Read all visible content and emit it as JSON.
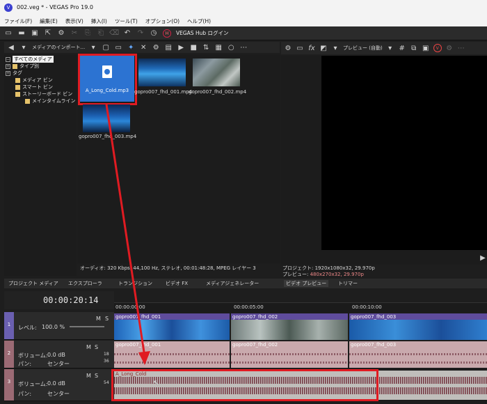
{
  "window": {
    "title": "002.veg * - VEGAS Pro 19.0"
  },
  "menu": [
    "ファイル(F)",
    "編集(E)",
    "表示(V)",
    "挿入(I)",
    "ツール(T)",
    "オプション(O)",
    "ヘルプ(H)"
  ],
  "toolbar": {
    "hub_label": "VEGAS Hub ログイン"
  },
  "media": {
    "import_label": "メディアのインポート...",
    "tree": [
      {
        "label": "すべてのメディア"
      },
      {
        "label": "タイプ別"
      },
      {
        "label": "タグ"
      },
      {
        "label": "メディア ビン"
      },
      {
        "label": "スマート ビン"
      },
      {
        "label": "ストーリーボード ビン"
      },
      {
        "label": "メインタイムライン"
      }
    ],
    "items": [
      {
        "name": "A_Long_Cold.mp3"
      },
      {
        "name": "gopro007_fhd_001.mp4"
      },
      {
        "name": "gopro007_fhd_002.mp4"
      },
      {
        "name": "gopro007_fhd_003.mp4"
      }
    ],
    "status": "オーディオ: 320 Kbps, 44,100 Hz, ステレオ, 00:01:48:28, MPEG レイヤー 3"
  },
  "tabs": [
    "プロジェクト メディア",
    "エクスプローラ",
    "トランジション",
    "ビデオ FX",
    "メディアジェネレーター",
    "ビデオ プレビュー",
    "トリマー"
  ],
  "preview": {
    "mode_label": "プレビュー (自動)",
    "project_line": "プロジェクト: 1920x1080x32, 29.970p",
    "preview_label": "プレビュー:",
    "preview_value": "480x270x32, 29.970p"
  },
  "timeline": {
    "timecode": "00:00:20:14",
    "ruler": [
      "00:00:00:00",
      "00:00:05:00",
      "00:00:10:00"
    ],
    "tracks": [
      {
        "number": "1",
        "row1_label": "レベル:",
        "row1_value": "100.0 %",
        "m": "M",
        "s": "S"
      },
      {
        "number": "2",
        "row1_label": "ボリューム:",
        "row1_value": "0.0 dB",
        "row2_label": "パン:",
        "row2_value": "センター",
        "m": "M",
        "s": "S"
      },
      {
        "number": "3",
        "row1_label": "ボリューム:",
        "row1_value": "0.0 dB",
        "row2_label": "パン:",
        "row2_value": "センター",
        "m": "M",
        "s": "S"
      }
    ],
    "video_clips": [
      "gopro007_fhd_001",
      "gopro007_fhd_002",
      "gopro007_fhd_003"
    ],
    "audio_clips": [
      "gopro007_fhd_001",
      "gopro007_fhd_002",
      "gopro007_fhd_003"
    ],
    "music_clip": "A_Long_Cold",
    "meter_labels": [
      "18",
      "36",
      "54"
    ]
  },
  "colors": {
    "highlight": "#e01b22",
    "selection": "#2c73d2",
    "audio_clip": "#c9a9ad",
    "music_clip": "#c0bebb"
  }
}
